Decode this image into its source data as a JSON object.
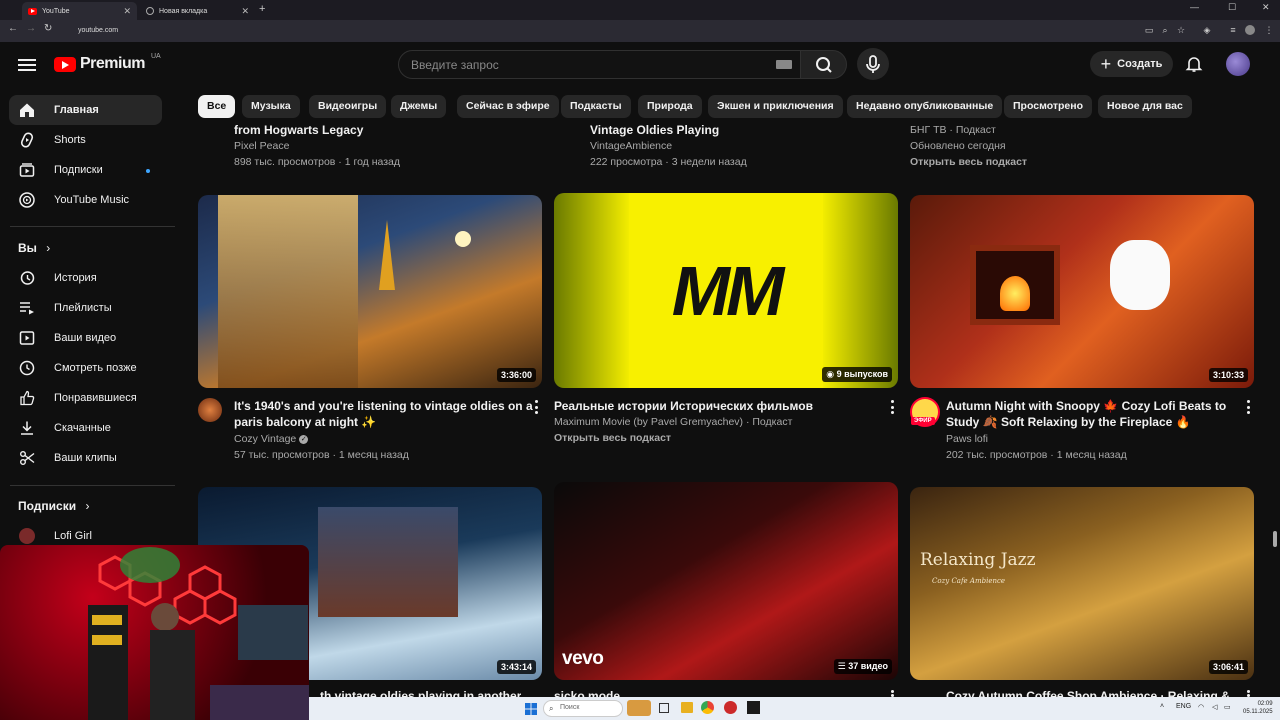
{
  "browser": {
    "tabs": [
      {
        "title": "YouTube",
        "active": true
      },
      {
        "title": "Новая вкладка",
        "active": false
      }
    ],
    "url": "youtube.com"
  },
  "header": {
    "logo_word": "Premium",
    "region": "UA",
    "search_placeholder": "Введите запрос",
    "create_label": "Создать",
    "accent": "#ff0000"
  },
  "chips": [
    "Все",
    "Музыка",
    "Видеоигры",
    "Джемы",
    "Сейчас в эфире",
    "Подкасты",
    "Природа",
    "Экшен и приключения",
    "Недавно опубликованные",
    "Просмотрено",
    "Новое для вас"
  ],
  "sidebar": {
    "main": [
      {
        "label": "Главная",
        "icon": "home-icon"
      },
      {
        "label": "Shorts",
        "icon": "shorts-icon"
      },
      {
        "label": "Подписки",
        "icon": "subscriptions-icon"
      },
      {
        "label": "YouTube Music",
        "icon": "youtube-music-icon"
      }
    ],
    "you_heading": "Вы",
    "you": [
      {
        "label": "История",
        "icon": "history-icon"
      },
      {
        "label": "Плейлисты",
        "icon": "playlists-icon"
      },
      {
        "label": "Ваши видео",
        "icon": "your-videos-icon"
      },
      {
        "label": "Смотреть позже",
        "icon": "watch-later-icon"
      },
      {
        "label": "Понравившиеся",
        "icon": "liked-icon"
      },
      {
        "label": "Скачанные",
        "icon": "downloads-icon"
      },
      {
        "label": "Ваши клипы",
        "icon": "clips-icon"
      }
    ],
    "subs_heading": "Подписки",
    "subs": [
      {
        "label": "Lofi Girl"
      }
    ]
  },
  "top_partial": [
    {
      "title": "from Hogwarts Legacy",
      "channel": "Pixel Peace",
      "meta": "898 тыс. просмотров · 1 год назад"
    },
    {
      "title": "Vintage Oldies Playing",
      "channel": "VintageAmbience",
      "meta": "222 просмотра · 3 недели назад"
    },
    {
      "title": "",
      "channel": "БНГ ТВ · Подкаст",
      "meta": "Обновлено сегодня",
      "extra": "Открыть весь подкаст"
    }
  ],
  "videos_row1": [
    {
      "title_l1": "It's 1940's and you're listening to vintage oldies on a",
      "title_l2": "paris balcony at night ✨",
      "channel": "Cozy Vintage",
      "meta": "57 тыс. просмотров · 1 месяц назад",
      "duration": "3:36:00"
    },
    {
      "title_l1": "Реальные истории Исторических фильмов",
      "title_l2": "",
      "channel": "Maximum Movie (by Pavel Gremyachev) · Подкаст",
      "meta": "Открыть весь подкаст",
      "duration": "9 выпусков",
      "thumb_text": "MM"
    },
    {
      "title_l1": "Autumn Night with Snoopy 🍁 Cozy Lofi Beats to",
      "title_l2": "Study 🍂 Soft Relaxing by the Fireplace 🔥",
      "channel": "Paws lofi",
      "meta": "202 тыс. просмотров · 1 месяц назад",
      "duration": "3:10:33",
      "live_badge": "ЭФИР"
    }
  ],
  "videos_row2": [
    {
      "duration": "3:43:14",
      "title_partial": "...th vintage oldies playing in another"
    },
    {
      "duration": "37 видео",
      "thumb_text": "vevo",
      "title_partial": "sicko mode"
    },
    {
      "duration": "3:06:41",
      "thumb_text": "Relaxing Jazz",
      "thumb_sub": "Cozy Cafe Ambience",
      "title_partial": "Cozy Autumn Coffee Shop Ambience · Relaxing &"
    }
  ],
  "taskbar": {
    "search_placeholder": "Поиск",
    "lang": "ENG",
    "time": "02:09",
    "date": "05.11.2025"
  }
}
